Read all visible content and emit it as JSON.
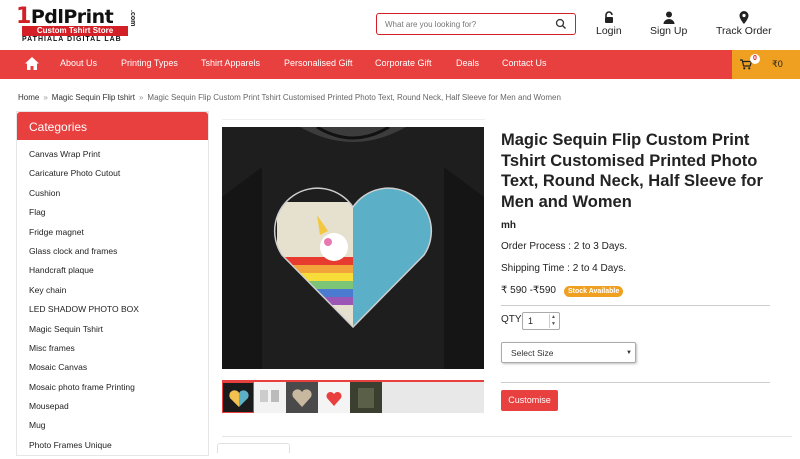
{
  "logo": {
    "line1_prefix": "1",
    "line1": "PdlPrint",
    "line2": "Custom Tshirt Store",
    "line3": "PATHIALA DIGITAL LAB",
    "com": ".com"
  },
  "search": {
    "placeholder": "What are you looking for?",
    "icon": "search-icon"
  },
  "account": {
    "login": "Login",
    "signup": "Sign Up",
    "track": "Track Order"
  },
  "nav": {
    "items": [
      "About Us",
      "Printing Types",
      "Tshirt Apparels",
      "Personalised Gift",
      "Corporate Gift",
      "Deals",
      "Contact Us"
    ]
  },
  "cart": {
    "count": "0",
    "amount": "₹0"
  },
  "breadcrumb": {
    "home": "Home",
    "category": "Magic Sequin Flip tshirt",
    "current": "Magic Sequin Flip Custom Print Tshirt Customised Printed Photo Text, Round Neck, Half Sleeve for Men and Women"
  },
  "categories": {
    "heading": "Categories",
    "items": [
      "Canvas Wrap Print",
      "Caricature Photo Cutout",
      "Cushion",
      "Flag",
      "Fridge magnet",
      "Glass clock and frames",
      "Handcraft plaque",
      "Key chain",
      "LED SHADOW PHOTO BOX",
      "Magic Sequin Tshirt",
      "Misc frames",
      "Mosaic Canvas",
      "Mosaic photo frame Printing",
      "Mousepad",
      "Mug",
      "Photo Frames Unique"
    ]
  },
  "product": {
    "title": "Magic Sequin Flip Custom Print Tshirt Customised Printed Photo Text, Round Neck, Half Sleeve for Men and Women",
    "brand": "mh",
    "order_process": "Order Process : 2 to 3 Days.",
    "shipping_time": "Shipping Time : 2 to 4 Days.",
    "price": "₹ 590 -₹590",
    "stock": "Stock Available",
    "qty_label": "QTY:",
    "qty_value": "1",
    "size_selected": "Select Size",
    "customise": "Customise"
  },
  "colors": {
    "accent": "#e8403f",
    "stock_badge": "#f0a020"
  }
}
